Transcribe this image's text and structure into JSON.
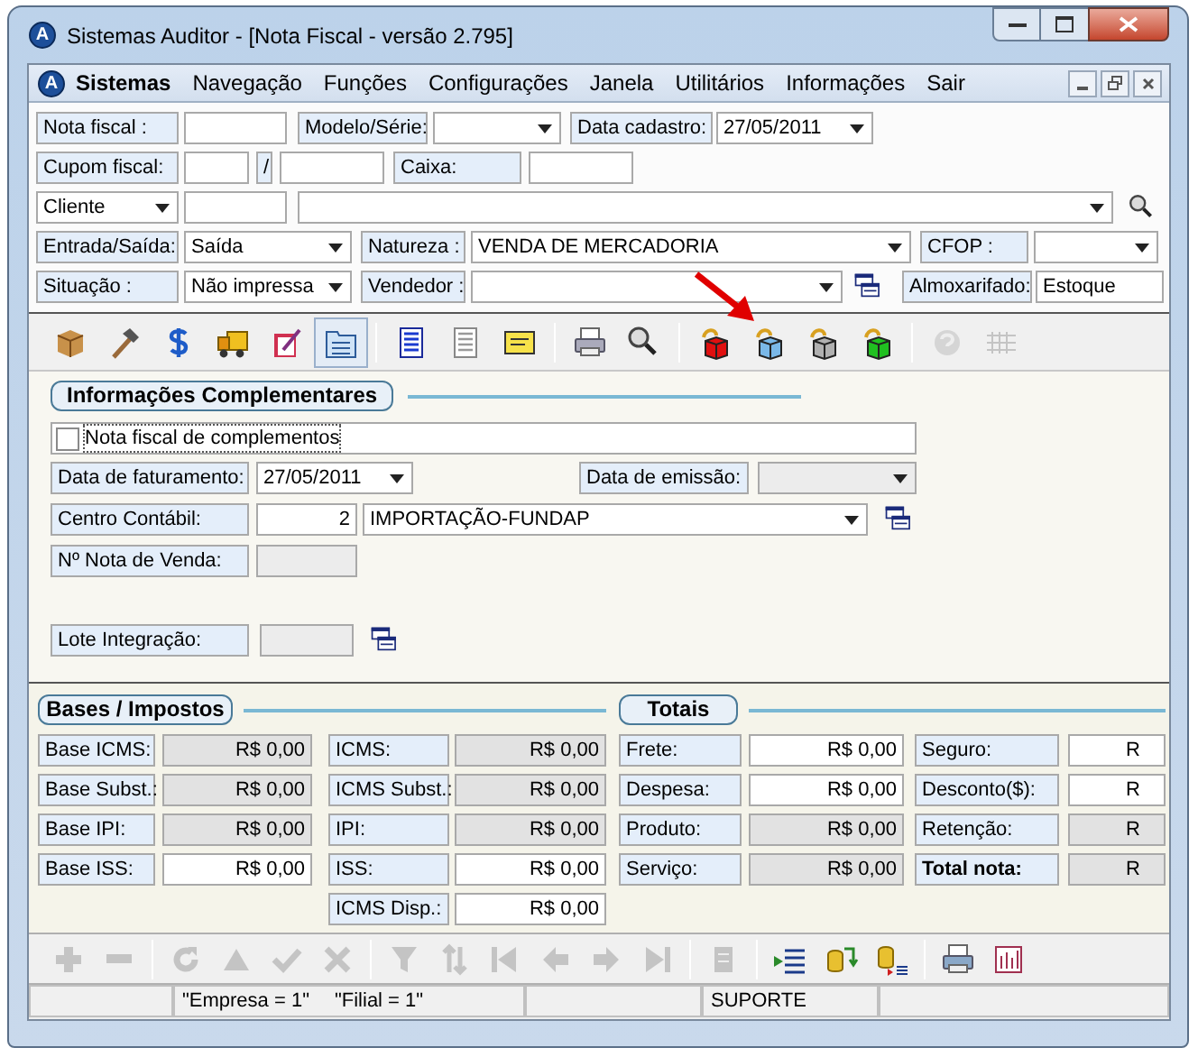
{
  "window": {
    "icon_letter": "A",
    "title": "Sistemas Auditor - [Nota Fiscal - versão 2.795]"
  },
  "menu": {
    "icon_letter": "A",
    "items": [
      {
        "label": "Sistemas",
        "bold": true
      },
      {
        "label": "Navegação",
        "bold": false
      },
      {
        "label": "Funções",
        "bold": false
      },
      {
        "label": "Configurações",
        "bold": false
      },
      {
        "label": "Janela",
        "bold": false
      },
      {
        "label": "Utilitários",
        "bold": false
      },
      {
        "label": "Informações",
        "bold": false
      },
      {
        "label": "Sair",
        "bold": false
      }
    ]
  },
  "header_form": {
    "lines": [
      {
        "fields": [
          {
            "kind": "label",
            "text": "Nota fiscal :"
          },
          {
            "kind": "input"
          },
          {
            "kind": "label",
            "text": "Modelo/Série:"
          },
          {
            "kind": "combo"
          },
          {
            "kind": "label",
            "text": "Data cadastro:"
          },
          {
            "kind": "combo",
            "value": "27/05/2011"
          }
        ]
      },
      {
        "fields": [
          {
            "kind": "label",
            "text": "Cupom fiscal:"
          },
          {
            "kind": "input"
          },
          {
            "kind": "slash",
            "text": "/"
          },
          {
            "kind": "input"
          },
          {
            "kind": "label",
            "text": "Caixa:"
          },
          {
            "kind": "input"
          }
        ]
      },
      {
        "fields": [
          {
            "kind": "combo",
            "value": "Cliente"
          },
          {
            "kind": "input"
          },
          {
            "kind": "combo"
          },
          {
            "kind": "search-button"
          }
        ]
      },
      {
        "fields": [
          {
            "kind": "label",
            "text": "Entrada/Saída:"
          },
          {
            "kind": "combo",
            "value": "Saída"
          },
          {
            "kind": "label",
            "text": "Natureza :"
          },
          {
            "kind": "combo",
            "value": "VENDA DE MERCADORIA"
          },
          {
            "kind": "label",
            "text": "CFOP :"
          },
          {
            "kind": "combo"
          }
        ]
      },
      {
        "fields": [
          {
            "kind": "label",
            "text": "Situação :"
          },
          {
            "kind": "combo",
            "value": "Não impressa"
          },
          {
            "kind": "label",
            "text": "Vendedor :"
          },
          {
            "kind": "combo"
          },
          {
            "kind": "lookup-button"
          },
          {
            "kind": "label",
            "text": "Almoxarifado:"
          },
          {
            "kind": "input",
            "value": "Estoque"
          }
        ]
      }
    ]
  },
  "main_toolbar": [
    {
      "selected": false,
      "disabled": false
    },
    {
      "selected": false,
      "disabled": false
    },
    {
      "selected": false,
      "disabled": false
    },
    {
      "selected": false,
      "disabled": false
    },
    {
      "selected": false,
      "disabled": false
    },
    {
      "selected": true,
      "disabled": false
    },
    {
      "selected": false,
      "disabled": false
    },
    {
      "selected": false,
      "disabled": false
    },
    {
      "selected": false,
      "disabled": false
    },
    {
      "selected": false,
      "disabled": false
    },
    {
      "selected": false,
      "disabled": false
    },
    {
      "selected": false,
      "disabled": false
    },
    {
      "selected": false,
      "disabled": false
    },
    {
      "selected": false,
      "disabled": false
    },
    {
      "selected": false,
      "disabled": false
    },
    {
      "selected": false,
      "disabled": true
    },
    {
      "selected": false,
      "disabled": true
    }
  ],
  "complementary_info": {
    "title": "Informações Complementares",
    "lines": [
      {
        "fields": [
          {
            "kind": "checkbox",
            "label": "Nota fiscal de complementos",
            "checked": false
          }
        ]
      },
      {
        "fields": [
          {
            "kind": "label",
            "text": "Data de faturamento:"
          },
          {
            "kind": "combo",
            "value": "27/05/2011",
            "disabled": false
          },
          {
            "kind": "label",
            "text": "Data de emissão:"
          },
          {
            "kind": "combo",
            "disabled": true
          }
        ]
      },
      {
        "fields": [
          {
            "kind": "label",
            "text": "Centro Contábil:"
          },
          {
            "kind": "number",
            "value": "2",
            "disabled": false
          },
          {
            "kind": "combo",
            "value": "IMPORTAÇÃO-FUNDAP",
            "disabled": false
          },
          {
            "kind": "lookup-button"
          }
        ]
      },
      {
        "fields": [
          {
            "kind": "label",
            "text": "Nº Nota de Venda:"
          },
          {
            "kind": "input",
            "disabled": true
          }
        ]
      },
      {
        "fields": [
          {
            "kind": "label",
            "text": "Lote Integração:"
          },
          {
            "kind": "input",
            "disabled": true
          },
          {
            "kind": "lookup-button"
          }
        ]
      }
    ]
  },
  "bases_impostos": {
    "title": "Bases / Impostos",
    "columns": [
      [
        {
          "label": "Base ICMS:",
          "value": "R$ 0,00",
          "editable": false
        },
        {
          "label": "Base Subst.:",
          "value": "R$ 0,00",
          "editable": false
        },
        {
          "label": "Base IPI:",
          "value": "R$ 0,00",
          "editable": false
        },
        {
          "label": "Base ISS:",
          "value": "R$ 0,00",
          "editable": true
        }
      ],
      [
        {
          "label": "ICMS:",
          "value": "R$ 0,00",
          "editable": false
        },
        {
          "label": "ICMS Subst.:",
          "value": "R$ 0,00",
          "editable": false
        },
        {
          "label": "IPI:",
          "value": "R$ 0,00",
          "editable": false
        },
        {
          "label": "ISS:",
          "value": "R$ 0,00",
          "editable": true
        },
        {
          "label": "ICMS Disp.:",
          "value": "R$ 0,00",
          "editable": true
        }
      ]
    ]
  },
  "totais": {
    "title": "Totais",
    "columns": [
      [
        {
          "label": "Frete:",
          "value": "R$ 0,00",
          "editable": true,
          "bold": false
        },
        {
          "label": "Despesa:",
          "value": "R$ 0,00",
          "editable": true,
          "bold": false
        },
        {
          "label": "Produto:",
          "value": "R$ 0,00",
          "editable": false,
          "bold": false
        },
        {
          "label": "Serviço:",
          "value": "R$ 0,00",
          "editable": false,
          "bold": false
        }
      ],
      [
        {
          "label": "Seguro:",
          "value": "R",
          "editable": true,
          "bold": false
        },
        {
          "label": "Desconto($):",
          "value": "R",
          "editable": true,
          "bold": false
        },
        {
          "label": "Retenção:",
          "value": "R",
          "editable": false,
          "bold": false
        },
        {
          "label": "Total nota:",
          "value": "R",
          "editable": false,
          "bold": true
        }
      ]
    ]
  },
  "record_toolbar": [
    {
      "disabled": true
    },
    {
      "disabled": true
    },
    {
      "disabled": true
    },
    {
      "disabled": true
    },
    {
      "disabled": true
    },
    {
      "disabled": true
    },
    {
      "disabled": true
    },
    {
      "disabled": true
    },
    {
      "disabled": true
    },
    {
      "disabled": true
    },
    {
      "disabled": true
    },
    {
      "disabled": true
    },
    {
      "disabled": true
    },
    {
      "disabled": false
    },
    {
      "disabled": false
    },
    {
      "disabled": false
    },
    {
      "disabled": false
    },
    {
      "disabled": false
    }
  ],
  "status_bar": {
    "company": "\"Empresa = 1\"",
    "branch": "\"Filial = 1\"",
    "user": "SUPORTE"
  }
}
